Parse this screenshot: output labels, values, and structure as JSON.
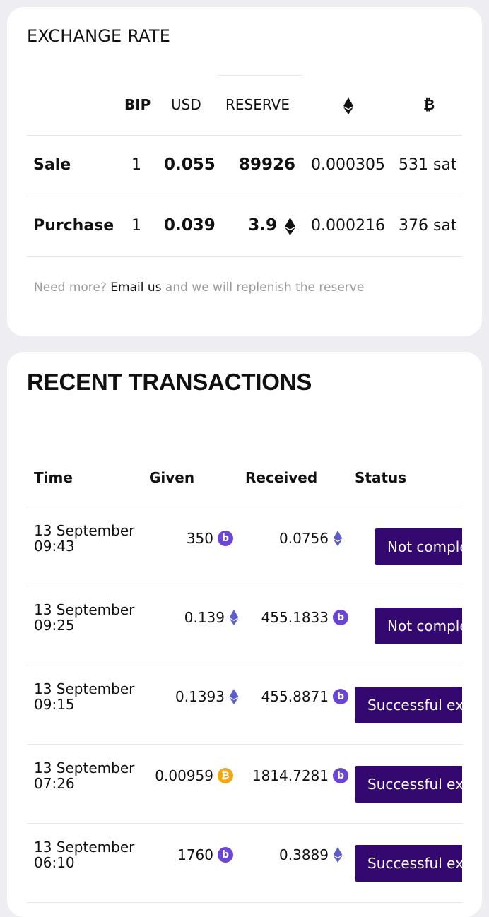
{
  "exchange": {
    "title": "EXCHANGE RATE",
    "headers": {
      "bip": "BIP",
      "usd": "USD",
      "reserve": "RESERVE",
      "eth_icon": "ethereum-icon",
      "btc_icon": "bitcoin-icon"
    },
    "rows": [
      {
        "label": "Sale",
        "bip": "1",
        "usd": "0.055",
        "reserve": "89926",
        "reserve_icon": "",
        "eth": "0.000305",
        "btc": "531 sat"
      },
      {
        "label": "Purchase",
        "bip": "1",
        "usd": "0.039",
        "reserve": "3.9",
        "reserve_icon": "ethereum-icon",
        "eth": "0.000216",
        "btc": "376 sat"
      }
    ],
    "note": {
      "prefix": "Need more?",
      "link": "Email us",
      "suffix": "and we will replenish the reserve"
    }
  },
  "transactions": {
    "title": "RECENT TRANSACTIONS",
    "headers": {
      "time": "Time",
      "given": "Given",
      "received": "Received",
      "status": "Status"
    },
    "rows": [
      {
        "date": "13 September",
        "time": "09:43",
        "given": "350",
        "given_icon": "bip-coin-icon",
        "received": "0.0756",
        "received_icon": "ethereum-icon",
        "status": "Not completed"
      },
      {
        "date": "13 September",
        "time": "09:25",
        "given": "0.139",
        "given_icon": "ethereum-icon",
        "received": "455.1833",
        "received_icon": "bip-coin-icon",
        "status": "Not completed"
      },
      {
        "date": "13 September",
        "time": "09:15",
        "given": "0.1393",
        "given_icon": "ethereum-icon",
        "received": "455.8871",
        "received_icon": "bip-coin-icon",
        "status": "Successful exchange"
      },
      {
        "date": "13 September",
        "time": "07:26",
        "given": "0.00959",
        "given_icon": "bitcoin-coin-icon",
        "received": "1814.7281",
        "received_icon": "bip-coin-icon",
        "status": "Successful exchange"
      },
      {
        "date": "13 September",
        "time": "06:10",
        "given": "1760",
        "given_icon": "bip-coin-icon",
        "received": "0.3889",
        "received_icon": "ethereum-icon",
        "status": "Successful exchange"
      }
    ]
  },
  "colors": {
    "status_button": "#33086f",
    "bip_coin": "#6a45d6",
    "btc_coin": "#f2a614",
    "eth_icon": "#5b5fc7"
  }
}
